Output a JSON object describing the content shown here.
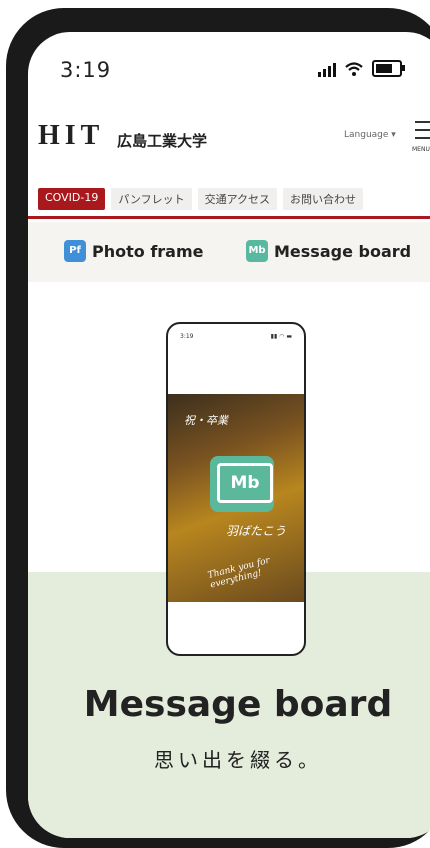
{
  "status": {
    "time": "3:19"
  },
  "header": {
    "logo": "HIT",
    "university": "広島工業大学",
    "language": "Language ▾",
    "menu_label": "MENU"
  },
  "nav": [
    "COVID-19",
    "パンフレット",
    "交通アクセス",
    "お問い合わせ"
  ],
  "tabs": [
    {
      "badge": "Pf",
      "label": "Photo frame"
    },
    {
      "badge": "Mb",
      "label": "Message board"
    }
  ],
  "mini_phone": {
    "time": "3:19",
    "logo": "Mb",
    "caption_1": "祝・卒業",
    "caption_2": "羽ばたこう",
    "caption_3": "Thank you for everything!"
  },
  "hero": {
    "title": "Message board",
    "subtitle": "思い出を綴る。"
  },
  "colors": {
    "brand_red": "#a8181c",
    "mint": "#5cb89b",
    "blue": "#3f8fd9"
  }
}
